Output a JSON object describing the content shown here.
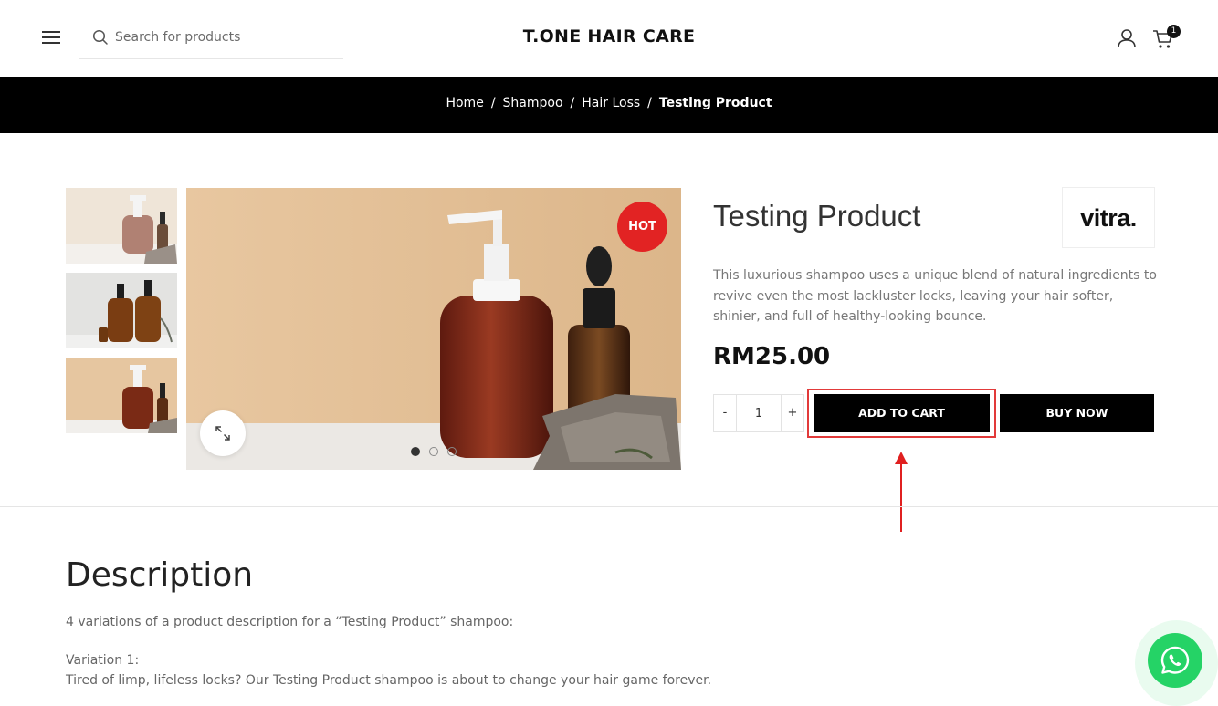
{
  "header": {
    "logo": "T.ONE HAIR CARE",
    "search_placeholder": "Search for products",
    "cart_count": "1",
    "icons": [
      "menu-icon",
      "search-icon",
      "user-icon",
      "cart-icon"
    ]
  },
  "breadcrumb": {
    "items": [
      "Home",
      "Shampoo",
      "Hair Loss"
    ],
    "separator": "/",
    "current": "Testing Product"
  },
  "gallery": {
    "badge": "HOT",
    "slides_total": 3,
    "active_slide": 1,
    "icons": [
      "expand-icon"
    ]
  },
  "product": {
    "title": "Testing Product",
    "brand": "vitra.",
    "description": "This luxurious shampoo uses a unique blend of natural ingredients to revive even the most lackluster locks, leaving your hair softer, shinier, and full of healthy-looking bounce.",
    "price": "RM25.00",
    "quantity": "1",
    "qty_minus": "-",
    "qty_plus": "+",
    "add_to_cart": "ADD TO CART",
    "buy_now": "BUY NOW"
  },
  "description_section": {
    "heading": "Description",
    "intro": "4 variations of a product description for a “Testing Product” shampoo:",
    "variation_label": "Variation 1:",
    "variation_text": "Tired of limp, lifeless locks? Our Testing Product shampoo is about to change your hair game forever."
  },
  "colors": {
    "accent_black": "#000000",
    "hot_badge": "#e22323",
    "highlight": "#e23a3a",
    "whatsapp": "#25d366"
  }
}
